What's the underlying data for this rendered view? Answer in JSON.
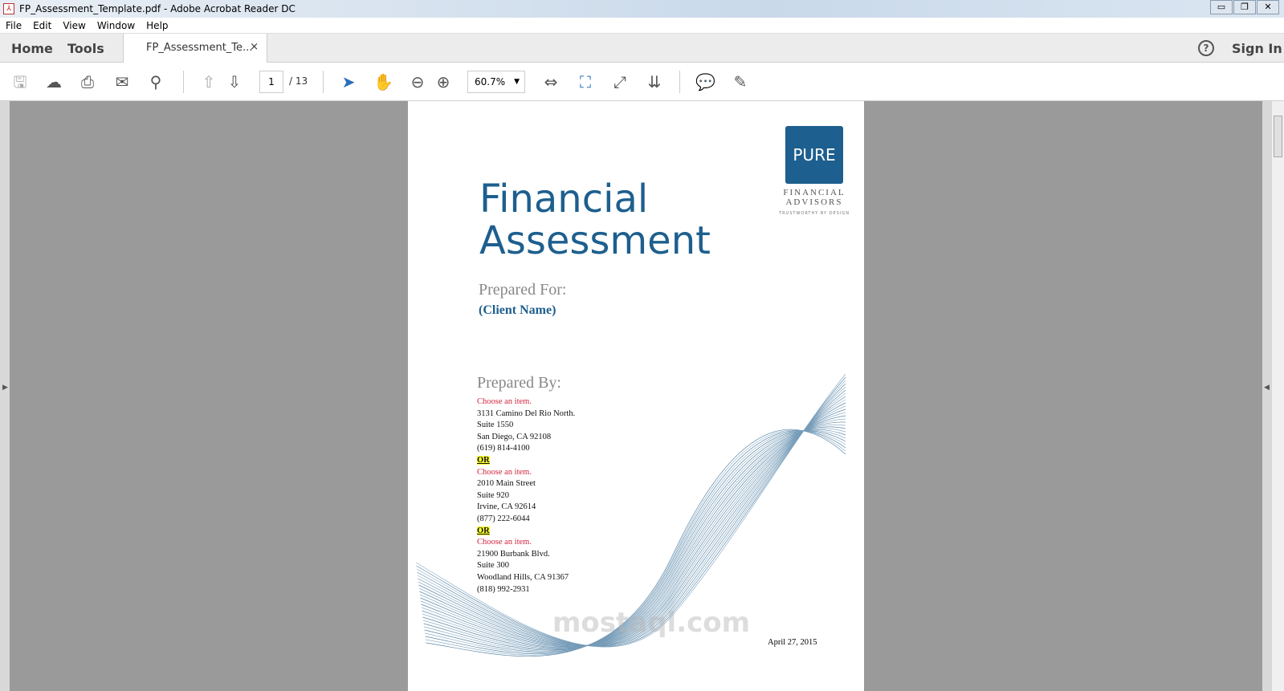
{
  "window": {
    "title": "FP_Assessment_Template.pdf - Adobe Acrobat Reader DC"
  },
  "menu": [
    "File",
    "Edit",
    "View",
    "Window",
    "Help"
  ],
  "nav": {
    "home": "Home",
    "tools": "Tools",
    "doc_tab": "FP_Assessment_Te...",
    "close": "×",
    "help": "?",
    "sign_in": "Sign In"
  },
  "toolbar": {
    "page_current": "1",
    "page_total": "/ 13",
    "zoom": "60.7%"
  },
  "document": {
    "title_line1": "Financial",
    "title_line2": "Assessment",
    "logo": {
      "mark": "PURE",
      "line1": "FINANCIAL",
      "line2": "ADVISORS",
      "tagline": "TRUSTWORTHY BY DESIGN"
    },
    "prepared_for": "Prepared For:",
    "client_name": "(Client Name)",
    "prepared_by": "Prepared By:",
    "offices": [
      {
        "choose": "Choose an item.",
        "lines": [
          "3131 Camino Del Rio North.",
          "Suite 1550",
          "San Diego, CA 92108",
          "(619) 814-4100"
        ]
      },
      {
        "choose": "Choose an item.",
        "lines": [
          "2010 Main Street",
          "Suite 920",
          "Irvine, CA 92614",
          "(877) 222-6044"
        ]
      },
      {
        "choose": "Choose an item.",
        "lines": [
          "21900 Burbank Blvd.",
          "Suite 300",
          "Woodland Hills, CA  91367",
          "(818) 992-2931"
        ]
      }
    ],
    "or": "OR",
    "date": "April 27, 2015"
  },
  "watermark": "mostaql.com",
  "colors": {
    "brand": "#1d5f8e",
    "red": "#d0243c",
    "highlight": "#ffff33"
  }
}
